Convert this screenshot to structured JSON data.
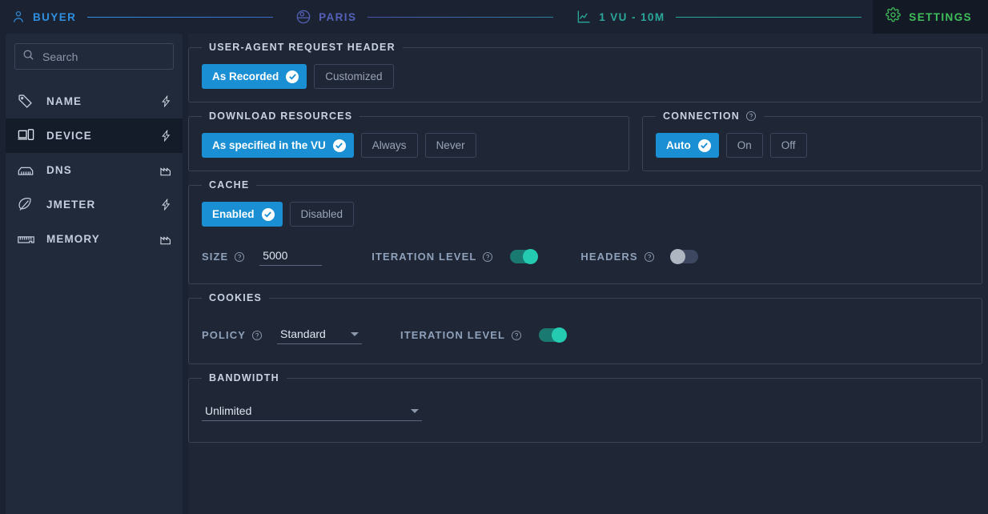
{
  "topbar": {
    "crumbs": [
      {
        "label": "BUYER",
        "icon": "user-icon",
        "color": "#2f8fe0"
      },
      {
        "label": "PARIS",
        "icon": "globe-icon",
        "color": "#5560b8"
      },
      {
        "label": "1 VU - 10M",
        "icon": "chart-line-icon",
        "color": "#2aa79a"
      }
    ],
    "settings": {
      "label": "SETTINGS",
      "icon": "gear-icon",
      "color": "#3fbf5b"
    }
  },
  "sidebar": {
    "search": {
      "placeholder": "Search",
      "value": ""
    },
    "items": [
      {
        "label": "NAME",
        "icon": "tag-icon",
        "badge": "lightning-icon",
        "active": false
      },
      {
        "label": "DEVICE",
        "icon": "devices-icon",
        "badge": "lightning-icon",
        "active": true
      },
      {
        "label": "DNS",
        "icon": "router-icon",
        "badge": "factory-icon",
        "active": false
      },
      {
        "label": "JMETER",
        "icon": "feather-icon",
        "badge": "lightning-icon",
        "active": false
      },
      {
        "label": "MEMORY",
        "icon": "ram-icon",
        "badge": "factory-icon",
        "active": false
      }
    ]
  },
  "main": {
    "user_agent": {
      "legend": "USER-AGENT REQUEST HEADER",
      "options": [
        {
          "label": "As Recorded",
          "selected": true
        },
        {
          "label": "Customized",
          "selected": false
        }
      ]
    },
    "download_resources": {
      "legend": "DOWNLOAD RESOURCES",
      "options": [
        {
          "label": "As specified in the VU",
          "selected": true
        },
        {
          "label": "Always",
          "selected": false
        },
        {
          "label": "Never",
          "selected": false
        }
      ]
    },
    "connection": {
      "legend": "CONNECTION",
      "help": "help-icon",
      "options": [
        {
          "label": "Auto",
          "selected": true
        },
        {
          "label": "On",
          "selected": false
        },
        {
          "label": "Off",
          "selected": false
        }
      ]
    },
    "cache": {
      "legend": "CACHE",
      "options": [
        {
          "label": "Enabled",
          "selected": true
        },
        {
          "label": "Disabled",
          "selected": false
        }
      ],
      "size_label": "SIZE",
      "size_value": "5000",
      "iteration_label": "ITERATION LEVEL",
      "iteration_on": true,
      "headers_label": "HEADERS",
      "headers_on": false
    },
    "cookies": {
      "legend": "COOKIES",
      "policy_label": "POLICY",
      "policy_value": "Standard",
      "iteration_label": "ITERATION LEVEL",
      "iteration_on": true
    },
    "bandwidth": {
      "legend": "BANDWIDTH",
      "value": "Unlimited"
    }
  },
  "colors": {
    "accent_blue": "#1b8fd4",
    "accent_teal": "#25cbb0",
    "settings_green": "#3fbf5b",
    "panel_bg": "#1f2736",
    "sidebar_bg": "#212a3b"
  }
}
